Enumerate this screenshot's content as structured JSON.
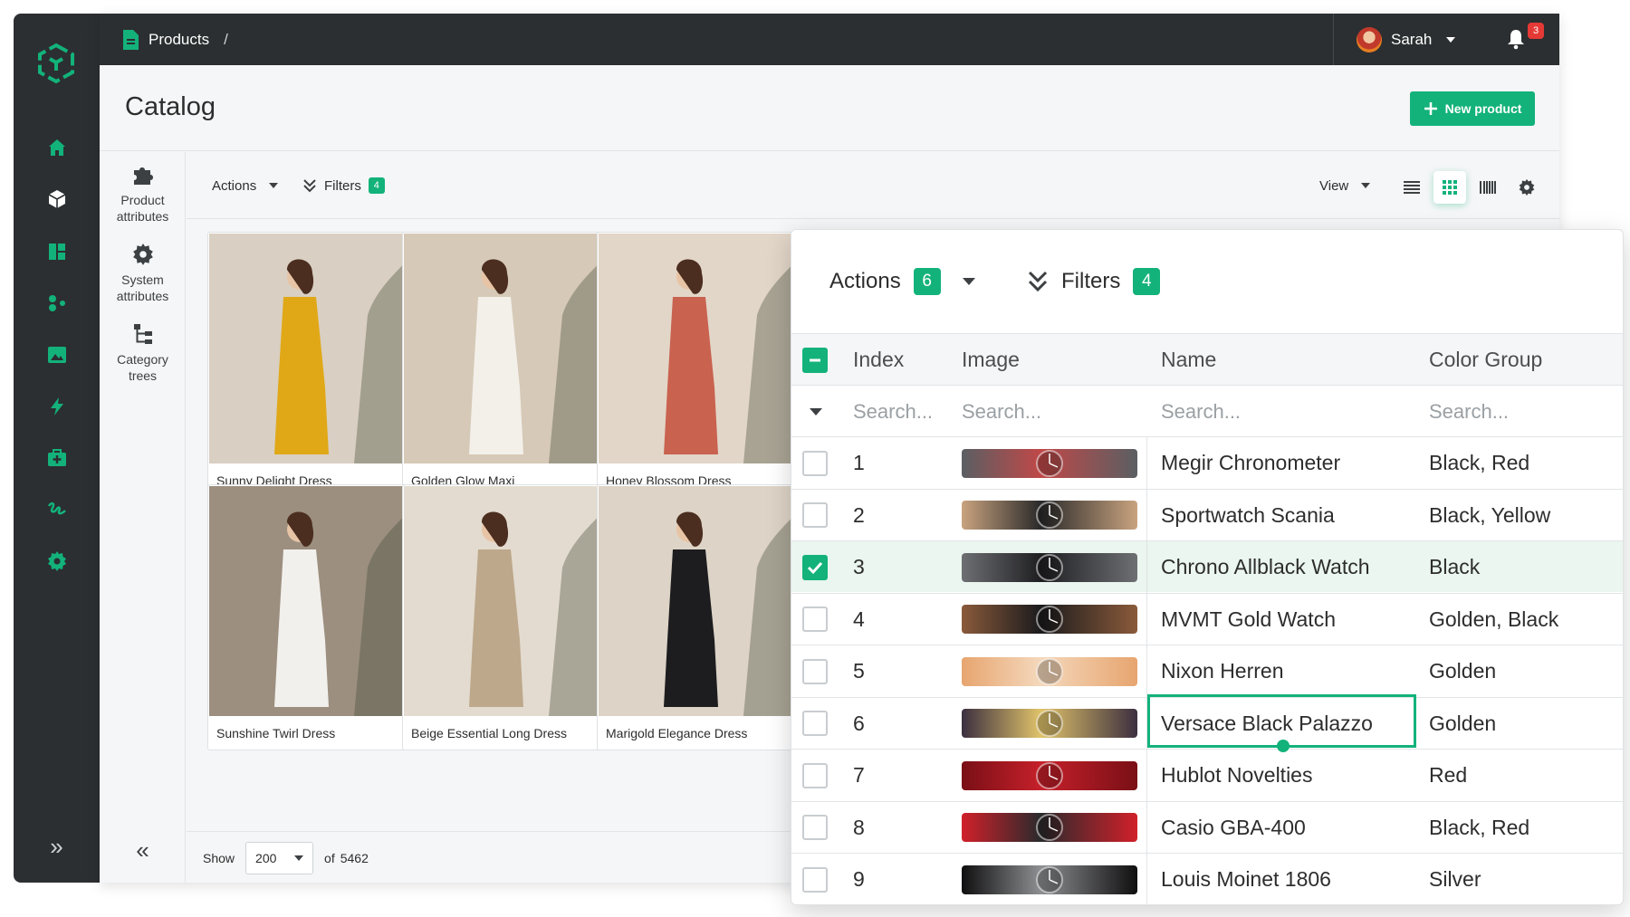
{
  "app": {
    "breadcrumb": "Products",
    "breadcrumb_sep": "/",
    "user_name": "Sarah",
    "notifications_count": "3",
    "accent_color": "#13b27b"
  },
  "rail": {
    "items": [
      "home-icon",
      "cube-icon",
      "dashboard-icon",
      "cluster-icon",
      "image-icon",
      "bolt-icon",
      "medkit-icon",
      "signature-icon",
      "gear-icon"
    ],
    "expand_label": "»"
  },
  "header": {
    "title": "Catalog",
    "new_button": "New product"
  },
  "sidepanel": {
    "items": [
      {
        "line1": "Product",
        "line2": "attributes",
        "icon": "puzzle-icon"
      },
      {
        "line1": "System",
        "line2": "attributes",
        "icon": "gear-icon"
      },
      {
        "line1": "Category",
        "line2": "trees",
        "icon": "tree-icon"
      }
    ],
    "collapse_label": "«"
  },
  "toolbar": {
    "actions_label": "Actions",
    "filters_label": "Filters",
    "filters_count": "4",
    "view_label": "View"
  },
  "cards": [
    {
      "caption": "Sunny Delight Dress",
      "color": "#e0a817",
      "bg": "#d9cfc2"
    },
    {
      "caption": "Golden Glow Maxi",
      "color": "#f3f0ea",
      "bg": "#d6c9b7"
    },
    {
      "caption": "Honey Blossom Dress",
      "color": "#c9624f",
      "bg": "#e2d6c8"
    },
    {
      "caption": "Sunshine Twirl Dress",
      "color": "#f2f0ec",
      "bg": "#9c8f80"
    },
    {
      "caption": "Beige Essential Long Dress",
      "color": "#bda88c",
      "bg": "#e3dbcf"
    },
    {
      "caption": "Marigold Elegance Dress",
      "color": "#1d1d1f",
      "bg": "#ddd3c6"
    }
  ],
  "footer": {
    "show_label": "Show",
    "page_size": "200",
    "of_label": "of",
    "total": "5462"
  },
  "panel": {
    "actions_label": "Actions",
    "actions_count": "6",
    "filters_label": "Filters",
    "filters_count": "4",
    "columns": [
      "Index",
      "Image",
      "Name",
      "Color Group"
    ],
    "search_placeholder": "Search...",
    "rows": [
      {
        "index": "1",
        "name": "Megir Chronometer",
        "color_group": "Black, Red",
        "checked": false,
        "thumb": [
          "#5a5f63",
          "#c04848"
        ]
      },
      {
        "index": "2",
        "name": "Sportwatch Scania",
        "color_group": "Black, Yellow",
        "checked": false,
        "thumb": [
          "#c9a37f",
          "#2a2a2a"
        ]
      },
      {
        "index": "3",
        "name": "Chrono Allblack Watch",
        "color_group": "Black",
        "checked": true,
        "thumb": [
          "#6d6f72",
          "#1f1f22"
        ]
      },
      {
        "index": "4",
        "name": "MVMT Gold Watch",
        "color_group": "Golden, Black",
        "checked": false,
        "thumb": [
          "#8a5a3a",
          "#1b1b1d"
        ]
      },
      {
        "index": "5",
        "name": "Nixon Herren",
        "color_group": "Golden",
        "checked": false,
        "thumb": [
          "#e7a56f",
          "#f4d8bc"
        ]
      },
      {
        "index": "6",
        "name": "Versace Black Palazzo",
        "color_group": "Golden",
        "checked": false,
        "thumb": [
          "#3c2f3f",
          "#e0c36a"
        ]
      },
      {
        "index": "7",
        "name": "Hublot Novelties",
        "color_group": "Red",
        "checked": false,
        "thumb": [
          "#7a0f16",
          "#c5202a"
        ]
      },
      {
        "index": "8",
        "name": "Casio GBA-400",
        "color_group": "Black, Red",
        "checked": false,
        "thumb": [
          "#d1202a",
          "#2a2a2c"
        ]
      },
      {
        "index": "9",
        "name": "Louis Moinet 1806",
        "color_group": "Silver",
        "checked": false,
        "thumb": [
          "#0f0f10",
          "#8e8f92"
        ]
      }
    ]
  }
}
